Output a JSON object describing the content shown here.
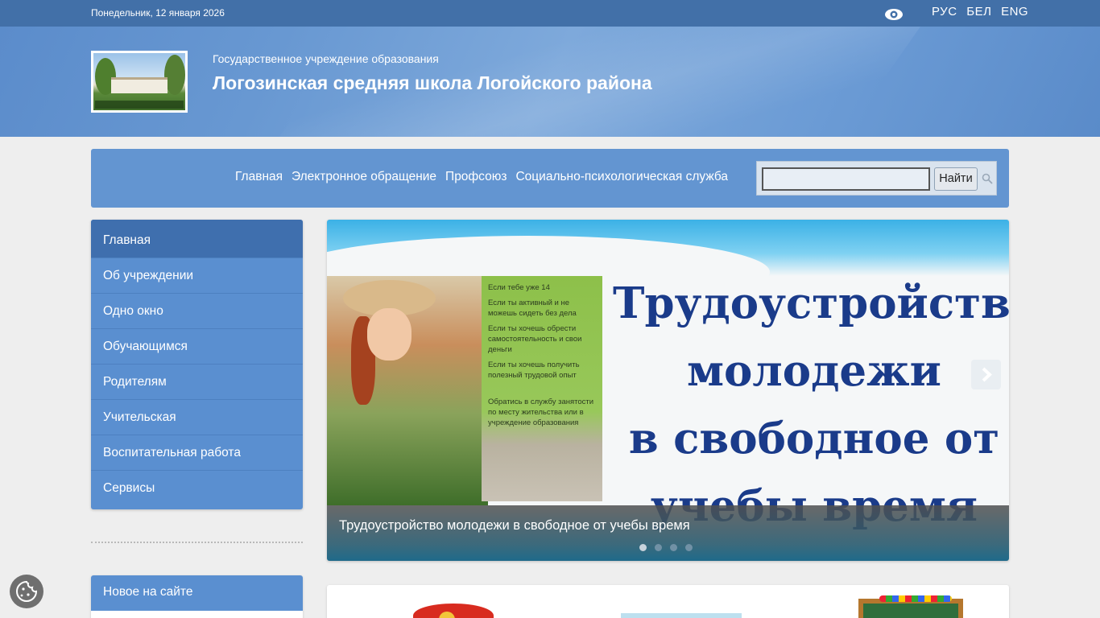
{
  "topbar": {
    "date": "Понедельник, 12 января 2026",
    "eye_icon": "eye-icon",
    "languages": [
      "РУС",
      "БЕЛ",
      "ENG"
    ]
  },
  "header": {
    "subtitle": "Государственное учреждение образования",
    "title": "Логозинская средняя школа Логойского района"
  },
  "nav": {
    "items": [
      "Главная",
      "Электронное обращение",
      "Профсоюз",
      "Социально-психологическая служба"
    ],
    "search_button": "Найти",
    "search_value": ""
  },
  "sidebar": {
    "items": [
      {
        "label": "Главная",
        "active": true
      },
      {
        "label": "Об учреждении"
      },
      {
        "label": "Одно окно"
      },
      {
        "label": "Обучающимся"
      },
      {
        "label": "Родителям"
      },
      {
        "label": "Учительская"
      },
      {
        "label": "Воспитательная работа"
      },
      {
        "label": "Сервисы"
      }
    ],
    "new_block_title": "Новое на сайте"
  },
  "slider": {
    "caption": "Трудоустройство молодежи в свободное от учебы время",
    "image_text": {
      "heading_lines": [
        "Трудоустройство",
        "молодежи",
        "в свободное от",
        "учебы время"
      ],
      "panel": [
        "Если тебе уже 14",
        "Если ты активный и не можешь сидеть без дела",
        "Если ты хочешь обрести самостоятельность и свои деньги",
        "Если ты хочешь получить полезный трудовой опыт",
        "Обратись в службу занятости по месту жительства или в учреждение образования"
      ]
    },
    "pager_count": 4,
    "active_slide": 1
  },
  "colors": {
    "topbar": "#4270a8",
    "nav": "#6395d1",
    "menu": "#5a8fd0",
    "menu_active": "#3f6fae"
  }
}
